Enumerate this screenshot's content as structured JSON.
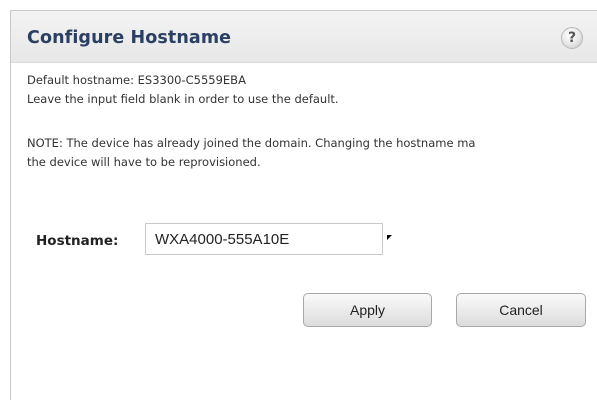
{
  "dialog": {
    "title": "Configure Hostname",
    "help_icon": "help-question-icon",
    "help_label": "?"
  },
  "info": {
    "default_hostname_line": "Default hostname: ES3300-C5559EBA",
    "blank_hint": "Leave the input field blank in order to use the default.",
    "note_line1": "NOTE: The device has already joined the domain. Changing the hostname ma",
    "note_line2": "the device will have to be reprovisioned."
  },
  "form": {
    "hostname_label": "Hostname:",
    "hostname_value": "WXA4000-555A10E"
  },
  "buttons": {
    "apply_label": "Apply",
    "cancel_label": "Cancel"
  },
  "colors": {
    "title_color": "#2b3f63",
    "titlebar_bg": "#ececec"
  }
}
